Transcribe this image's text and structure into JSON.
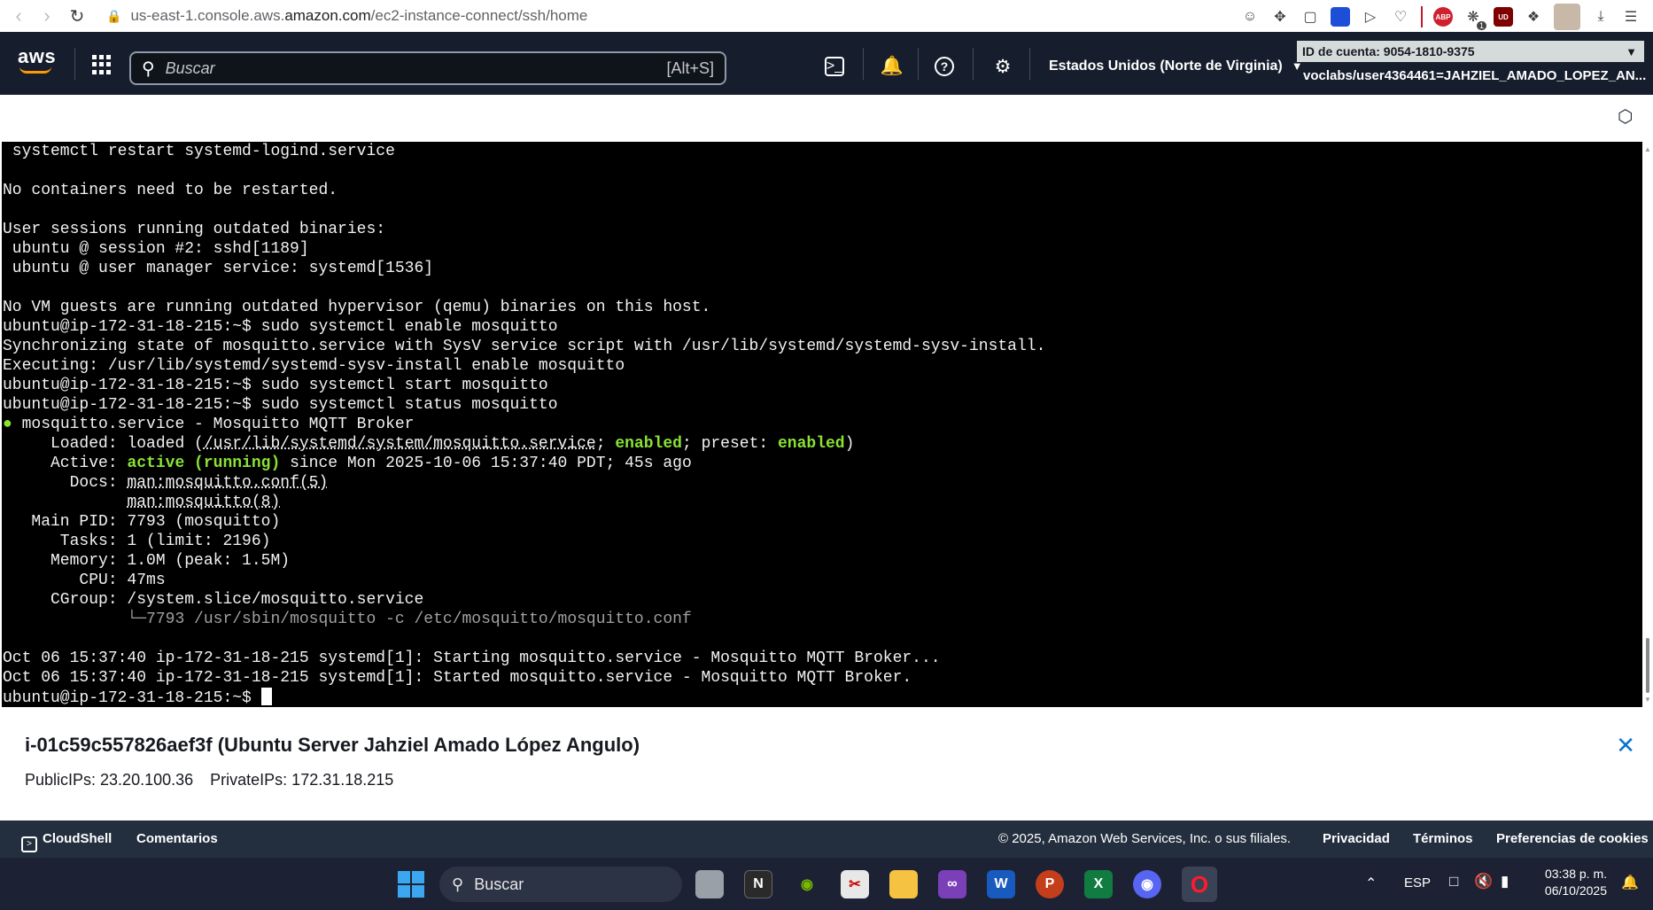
{
  "browser": {
    "url_scheme_host": "us-east-1.console.aws.",
    "url_domain": "amazon.com",
    "url_path": "/ec2-instance-connect/ssh/home",
    "back_icon": "back-arrow-icon",
    "forward_icon": "forward-arrow-icon",
    "reload_icon": "reload-icon",
    "extensions": {
      "abp_label": "ABP",
      "ub_label": "UD",
      "badge_count": "1"
    }
  },
  "aws_header": {
    "logo_text": "aws",
    "search_placeholder": "Buscar",
    "search_shortcut": "[Alt+S]",
    "region": "Estados Unidos (Norte de Virginia)",
    "account_id": "ID de cuenta: 9054-1810-9375",
    "user": "voclabs/user4364461=JAHZIEL_AMADO_LOPEZ_AN..."
  },
  "terminal": {
    "lines": [
      " systemctl restart systemd-logind.service",
      "",
      "No containers need to be restarted.",
      "",
      "User sessions running outdated binaries:",
      " ubuntu @ session #2: sshd[1189]",
      " ubuntu @ user manager service: systemd[1536]",
      "",
      "No VM guests are running outdated hypervisor (qemu) binaries on this host.",
      "ubuntu@ip-172-31-18-215:~$ sudo systemctl enable mosquitto",
      "Synchronizing state of mosquitto.service with SysV service script with /usr/lib/systemd/systemd-sysv-install.",
      "Executing: /usr/lib/systemd/systemd-sysv-install enable mosquitto",
      "ubuntu@ip-172-31-18-215:~$ sudo systemctl start mosquitto",
      "ubuntu@ip-172-31-18-215:~$ sudo systemctl status mosquitto"
    ],
    "status": {
      "bullet": "●",
      "service_line": " mosquitto.service - Mosquitto MQTT Broker",
      "loaded_label": "     Loaded: ",
      "loaded_pre": "loaded (",
      "loaded_path": "/usr/lib/systemd/system/mosquitto.service",
      "loaded_sep1": "; ",
      "enabled1": "enabled",
      "loaded_sep2": "; preset: ",
      "enabled2": "enabled",
      "loaded_end": ")",
      "active_label": "     Active: ",
      "active_state": "active (running)",
      "active_since": " since Mon 2025-10-06 15:37:40 PDT; 45s ago",
      "docs_label": "       Docs: ",
      "docs1": "man:mosquitto.conf(5)",
      "docs_indent": "             ",
      "docs2": "man:mosquitto(8)",
      "main_pid": "   Main PID: 7793 (mosquitto)",
      "tasks": "      Tasks: 1 (limit: 2196)",
      "memory": "     Memory: 1.0M (peak: 1.5M)",
      "cpu": "        CPU: 47ms",
      "cgroup": "     CGroup: /system.slice/mosquitto.service",
      "cgroup_child_indent": "             ",
      "cgroup_child": "└─7793 /usr/sbin/mosquitto -c /etc/mosquitto/mosquitto.conf"
    },
    "log_lines": [
      "",
      "Oct 06 15:37:40 ip-172-31-18-215 systemd[1]: Starting mosquitto.service - Mosquitto MQTT Broker...",
      "Oct 06 15:37:40 ip-172-31-18-215 systemd[1]: Started mosquitto.service - Mosquitto MQTT Broker."
    ],
    "prompt": "ubuntu@ip-172-31-18-215:~$ "
  },
  "instance": {
    "title": "i-01c59c557826aef3f (Ubuntu Server Jahziel Amado López Angulo)",
    "public_ips": "PublicIPs: 23.20.100.36",
    "private_ips": "PrivateIPs: 172.31.18.215"
  },
  "footer": {
    "cloudshell": "CloudShell",
    "comentarios": "Comentarios",
    "copyright": "© 2025, Amazon Web Services, Inc. o sus filiales.",
    "privacidad": "Privacidad",
    "terminos": "Términos",
    "cookies": "Preferencias de cookies"
  },
  "taskbar": {
    "search_label": "Buscar",
    "language": "ESP",
    "time": "03:38 p. m.",
    "date": "06/10/2025",
    "apps": [
      "file-explorer-taskview",
      "notion",
      "nvidia",
      "snipping-tool",
      "folder",
      "visual-studio",
      "word",
      "powerpoint",
      "excel",
      "discord",
      "opera"
    ]
  },
  "colors": {
    "aws_header_bg": "#161e2d",
    "aws_footer_bg": "#232f3e",
    "terminal_bg": "#000000",
    "terminal_green": "#8ae234",
    "link_blue": "#0972d3"
  }
}
